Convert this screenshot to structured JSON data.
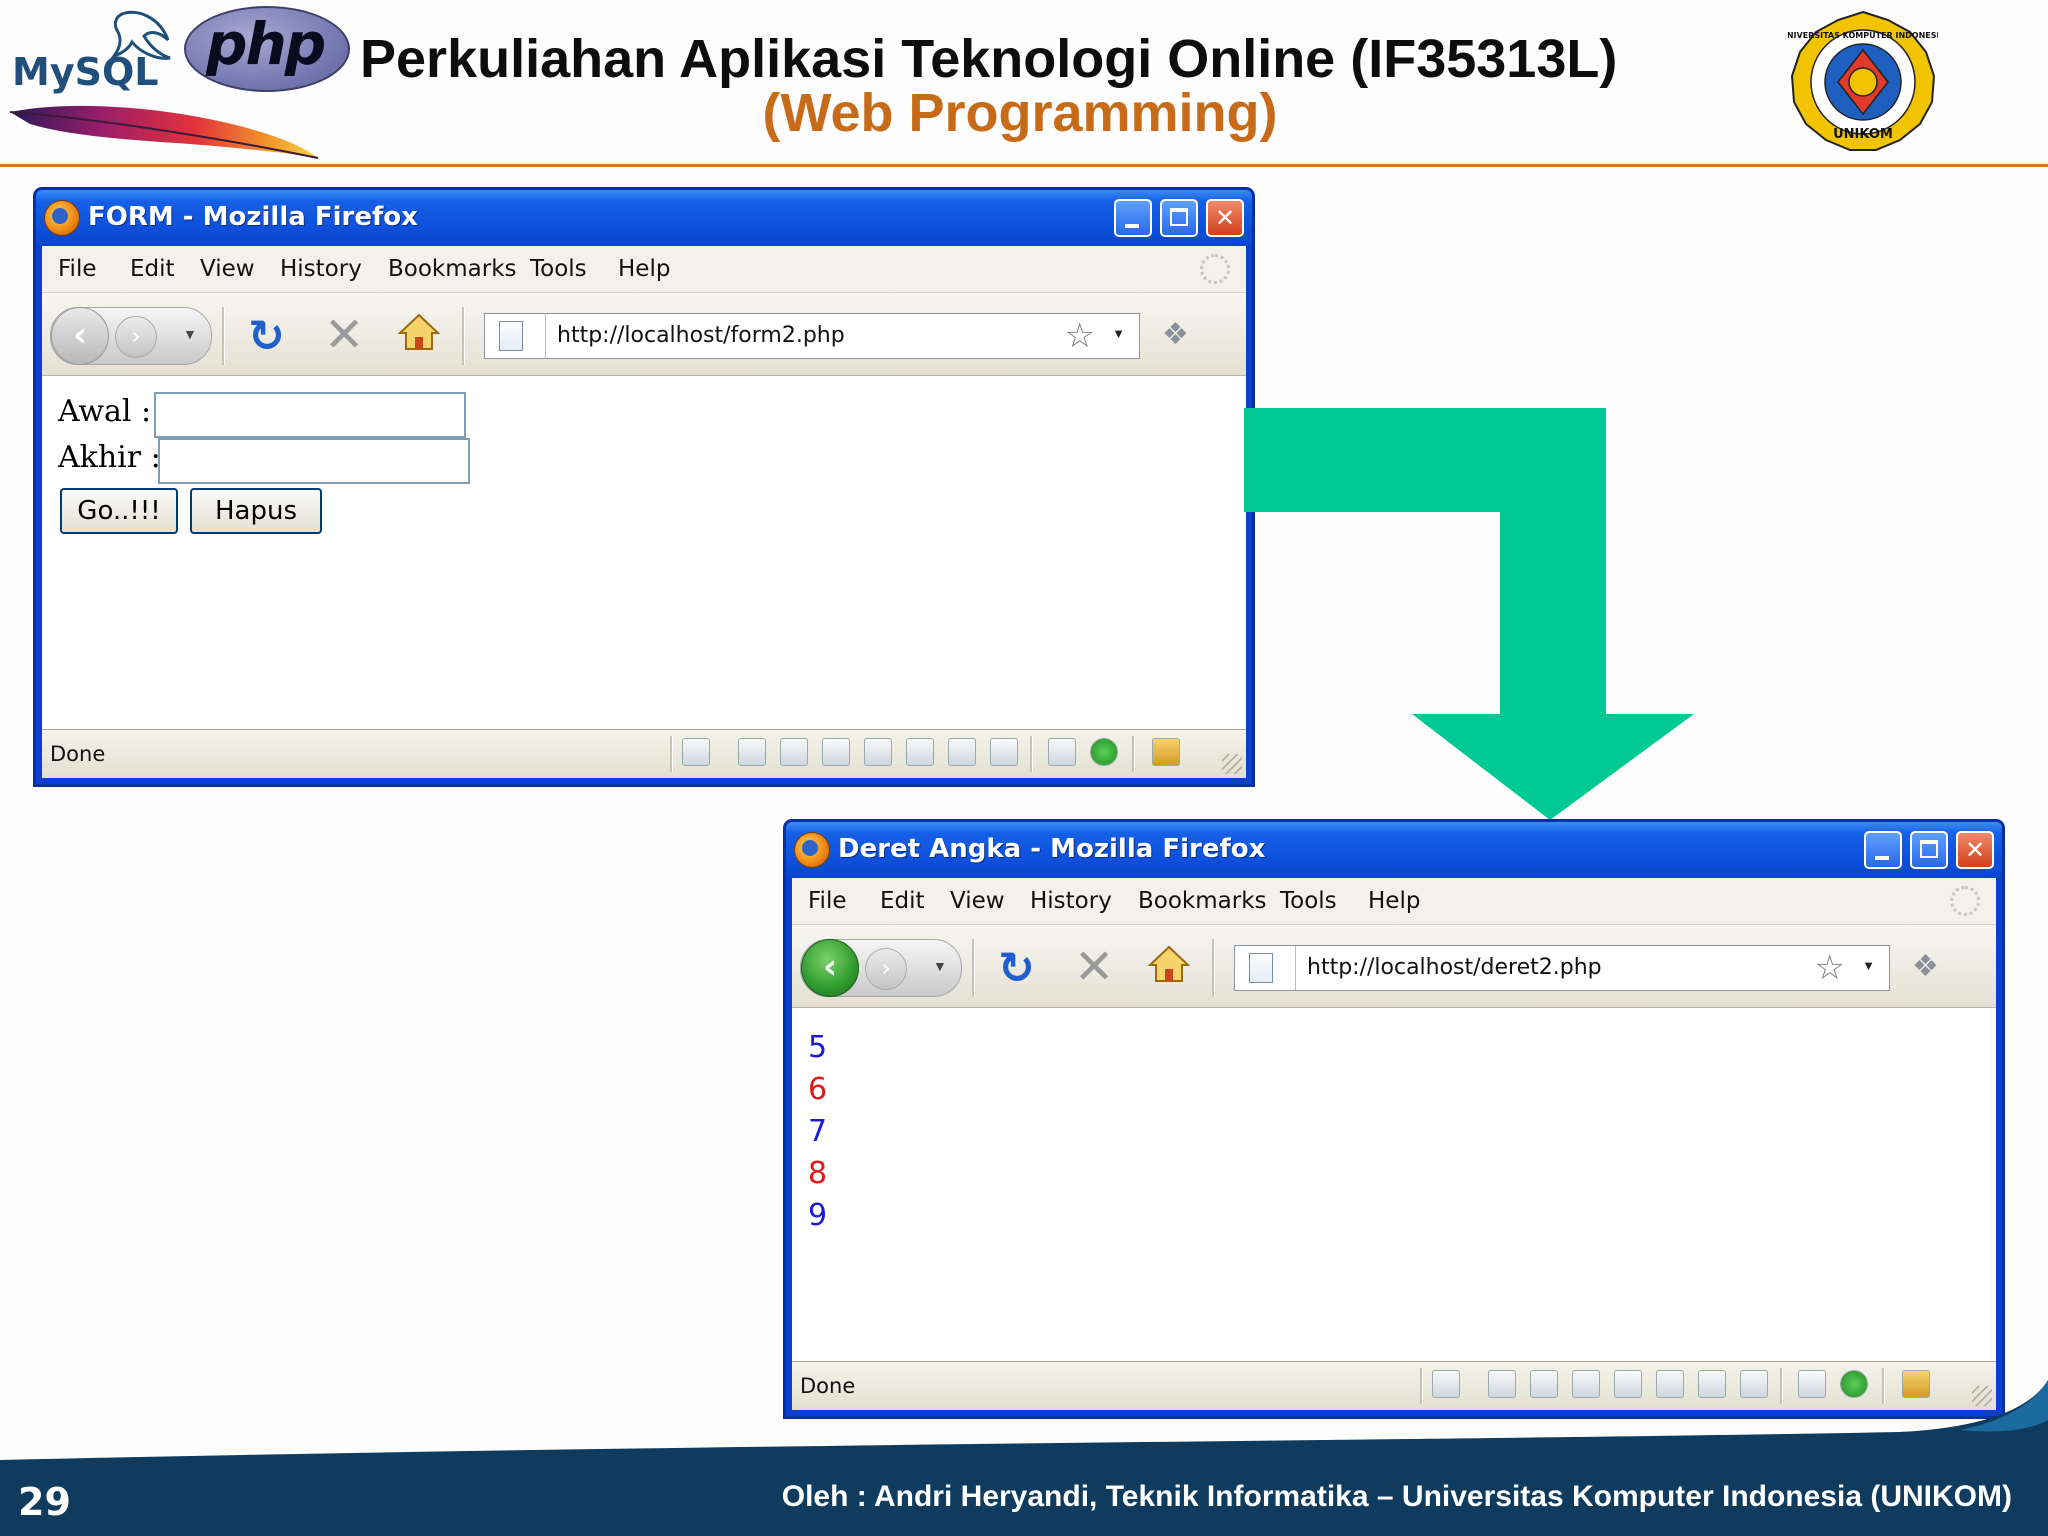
{
  "slide": {
    "title": "Perkuliahan Aplikasi Teknologi Online (IF35313L)",
    "subtitle": "(Web Programming)",
    "page_number": "29",
    "footer": "Oleh : Andri Heryandi, Teknik Informatika – Universitas Komputer Indonesia (UNIKOM)",
    "logos": {
      "mysql": "MySQL",
      "php": "php",
      "unikom_top": "UNIVERSITAS KOMPUTER INDONESIA",
      "unikom_bottom": "UNIKOM"
    },
    "colors": {
      "header_line": "#c8792a",
      "subtitle": "#c86b19",
      "arrow": "#00c996",
      "footer_bg": "#0f3b5e"
    }
  },
  "window_form": {
    "title": "FORM - Mozilla Firefox",
    "menu": [
      "File",
      "Edit",
      "View",
      "History",
      "Bookmarks",
      "Tools",
      "Help"
    ],
    "url": "http://localhost/form2.php",
    "status": "Done",
    "form": {
      "awal_label": "Awal :",
      "awal_value": "",
      "akhir_label": "Akhir :",
      "akhir_value": "",
      "go_button": "Go..!!!",
      "hapus_button": "Hapus"
    }
  },
  "window_deret": {
    "title": "Deret Angka - Mozilla Firefox",
    "menu": [
      "File",
      "Edit",
      "View",
      "History",
      "Bookmarks",
      "Tools",
      "Help"
    ],
    "url": "http://localhost/deret2.php",
    "status": "Done",
    "numbers": [
      {
        "value": "5",
        "color": "#1a1adb"
      },
      {
        "value": "6",
        "color": "#e01818"
      },
      {
        "value": "7",
        "color": "#1a1adb"
      },
      {
        "value": "8",
        "color": "#e01818"
      },
      {
        "value": "9",
        "color": "#1a1adb"
      }
    ]
  }
}
